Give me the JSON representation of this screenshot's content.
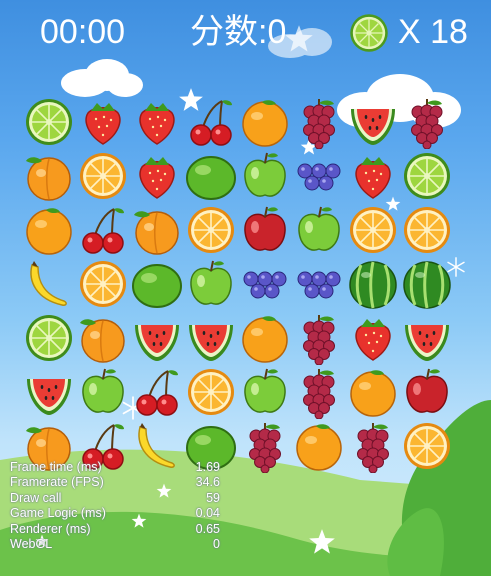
{
  "hud": {
    "timer": "00:00",
    "score": "分数:0",
    "lives": "X 18",
    "lives_icon": "lime-icon"
  },
  "stats": [
    {
      "label": "Frame time (ms)",
      "value": "1.69"
    },
    {
      "label": "Framerate (FPS)",
      "value": "34.6"
    },
    {
      "label": "Draw call",
      "value": "59"
    },
    {
      "label": "Game Logic (ms)",
      "value": "0.04"
    },
    {
      "label": "Renderer (ms)",
      "value": "0.65"
    },
    {
      "label": "WebGL",
      "value": "0"
    }
  ],
  "board": {
    "rows": 7,
    "cols": 8,
    "grid": [
      [
        "lime",
        "strawberry",
        "strawberry",
        "cherry",
        "orange",
        "grapes",
        "watermelon",
        "grapes"
      ],
      [
        "peach",
        "orange-slice",
        "strawberry",
        "lime-whole",
        "green-apple",
        "blueberry",
        "strawberry",
        "lime"
      ],
      [
        "orange",
        "cherry",
        "peach",
        "orange-slice",
        "red-apple",
        "green-apple",
        "orange-slice",
        "orange-slice"
      ],
      [
        "banana",
        "orange-slice",
        "lime-whole",
        "green-apple",
        "blueberry",
        "blueberry",
        "watermelon-whole",
        "watermelon-whole"
      ],
      [
        "lime",
        "peach",
        "watermelon",
        "watermelon",
        "orange",
        "grapes",
        "strawberry",
        "watermelon"
      ],
      [
        "watermelon",
        "green-apple",
        "cherry",
        "orange-slice",
        "green-apple",
        "grapes",
        "orange",
        "red-apple"
      ],
      [
        "peach",
        "cherry",
        "banana",
        "lime-whole",
        "grapes",
        "orange",
        "grapes",
        "orange-slice"
      ]
    ]
  },
  "colors": {
    "sky_top": "#3f8fe0",
    "sky_bottom": "#d7effd",
    "hill": "#5fb83c",
    "text": "#ffffff"
  }
}
